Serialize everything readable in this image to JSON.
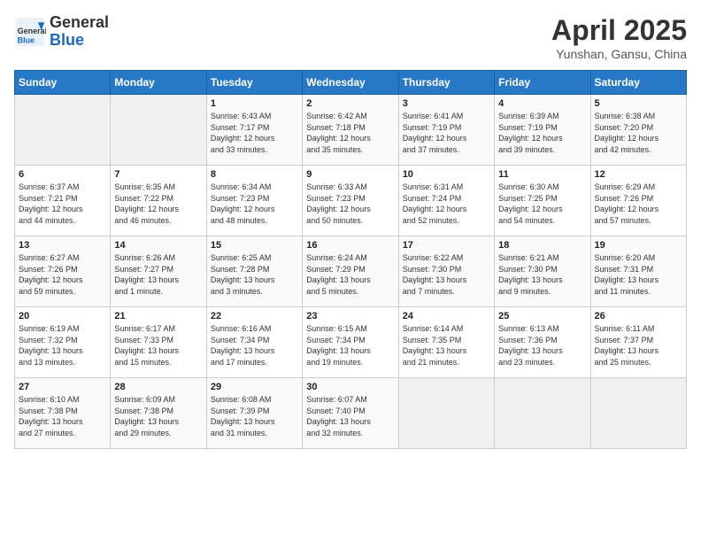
{
  "header": {
    "logo_general": "General",
    "logo_blue": "Blue",
    "title": "April 2025",
    "subtitle": "Yunshan, Gansu, China"
  },
  "days_of_week": [
    "Sunday",
    "Monday",
    "Tuesday",
    "Wednesday",
    "Thursday",
    "Friday",
    "Saturday"
  ],
  "weeks": [
    [
      {
        "day": "",
        "info": ""
      },
      {
        "day": "",
        "info": ""
      },
      {
        "day": "1",
        "info": "Sunrise: 6:43 AM\nSunset: 7:17 PM\nDaylight: 12 hours\nand 33 minutes."
      },
      {
        "day": "2",
        "info": "Sunrise: 6:42 AM\nSunset: 7:18 PM\nDaylight: 12 hours\nand 35 minutes."
      },
      {
        "day": "3",
        "info": "Sunrise: 6:41 AM\nSunset: 7:19 PM\nDaylight: 12 hours\nand 37 minutes."
      },
      {
        "day": "4",
        "info": "Sunrise: 6:39 AM\nSunset: 7:19 PM\nDaylight: 12 hours\nand 39 minutes."
      },
      {
        "day": "5",
        "info": "Sunrise: 6:38 AM\nSunset: 7:20 PM\nDaylight: 12 hours\nand 42 minutes."
      }
    ],
    [
      {
        "day": "6",
        "info": "Sunrise: 6:37 AM\nSunset: 7:21 PM\nDaylight: 12 hours\nand 44 minutes."
      },
      {
        "day": "7",
        "info": "Sunrise: 6:35 AM\nSunset: 7:22 PM\nDaylight: 12 hours\nand 46 minutes."
      },
      {
        "day": "8",
        "info": "Sunrise: 6:34 AM\nSunset: 7:23 PM\nDaylight: 12 hours\nand 48 minutes."
      },
      {
        "day": "9",
        "info": "Sunrise: 6:33 AM\nSunset: 7:23 PM\nDaylight: 12 hours\nand 50 minutes."
      },
      {
        "day": "10",
        "info": "Sunrise: 6:31 AM\nSunset: 7:24 PM\nDaylight: 12 hours\nand 52 minutes."
      },
      {
        "day": "11",
        "info": "Sunrise: 6:30 AM\nSunset: 7:25 PM\nDaylight: 12 hours\nand 54 minutes."
      },
      {
        "day": "12",
        "info": "Sunrise: 6:29 AM\nSunset: 7:26 PM\nDaylight: 12 hours\nand 57 minutes."
      }
    ],
    [
      {
        "day": "13",
        "info": "Sunrise: 6:27 AM\nSunset: 7:26 PM\nDaylight: 12 hours\nand 59 minutes."
      },
      {
        "day": "14",
        "info": "Sunrise: 6:26 AM\nSunset: 7:27 PM\nDaylight: 13 hours\nand 1 minute."
      },
      {
        "day": "15",
        "info": "Sunrise: 6:25 AM\nSunset: 7:28 PM\nDaylight: 13 hours\nand 3 minutes."
      },
      {
        "day": "16",
        "info": "Sunrise: 6:24 AM\nSunset: 7:29 PM\nDaylight: 13 hours\nand 5 minutes."
      },
      {
        "day": "17",
        "info": "Sunrise: 6:22 AM\nSunset: 7:30 PM\nDaylight: 13 hours\nand 7 minutes."
      },
      {
        "day": "18",
        "info": "Sunrise: 6:21 AM\nSunset: 7:30 PM\nDaylight: 13 hours\nand 9 minutes."
      },
      {
        "day": "19",
        "info": "Sunrise: 6:20 AM\nSunset: 7:31 PM\nDaylight: 13 hours\nand 11 minutes."
      }
    ],
    [
      {
        "day": "20",
        "info": "Sunrise: 6:19 AM\nSunset: 7:32 PM\nDaylight: 13 hours\nand 13 minutes."
      },
      {
        "day": "21",
        "info": "Sunrise: 6:17 AM\nSunset: 7:33 PM\nDaylight: 13 hours\nand 15 minutes."
      },
      {
        "day": "22",
        "info": "Sunrise: 6:16 AM\nSunset: 7:34 PM\nDaylight: 13 hours\nand 17 minutes."
      },
      {
        "day": "23",
        "info": "Sunrise: 6:15 AM\nSunset: 7:34 PM\nDaylight: 13 hours\nand 19 minutes."
      },
      {
        "day": "24",
        "info": "Sunrise: 6:14 AM\nSunset: 7:35 PM\nDaylight: 13 hours\nand 21 minutes."
      },
      {
        "day": "25",
        "info": "Sunrise: 6:13 AM\nSunset: 7:36 PM\nDaylight: 13 hours\nand 23 minutes."
      },
      {
        "day": "26",
        "info": "Sunrise: 6:11 AM\nSunset: 7:37 PM\nDaylight: 13 hours\nand 25 minutes."
      }
    ],
    [
      {
        "day": "27",
        "info": "Sunrise: 6:10 AM\nSunset: 7:38 PM\nDaylight: 13 hours\nand 27 minutes."
      },
      {
        "day": "28",
        "info": "Sunrise: 6:09 AM\nSunset: 7:38 PM\nDaylight: 13 hours\nand 29 minutes."
      },
      {
        "day": "29",
        "info": "Sunrise: 6:08 AM\nSunset: 7:39 PM\nDaylight: 13 hours\nand 31 minutes."
      },
      {
        "day": "30",
        "info": "Sunrise: 6:07 AM\nSunset: 7:40 PM\nDaylight: 13 hours\nand 32 minutes."
      },
      {
        "day": "",
        "info": ""
      },
      {
        "day": "",
        "info": ""
      },
      {
        "day": "",
        "info": ""
      }
    ]
  ]
}
